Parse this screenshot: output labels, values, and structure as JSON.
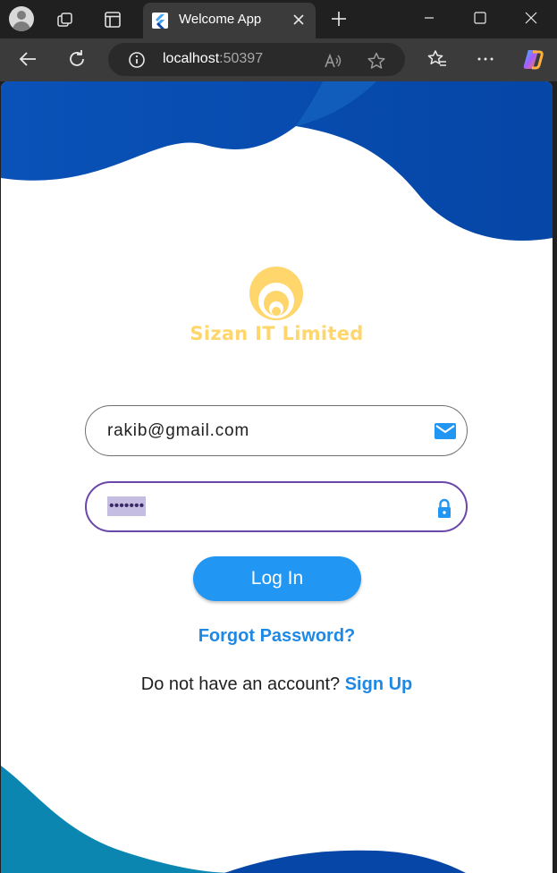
{
  "browser": {
    "tab_title": "Welcome App",
    "url_host": "localhost",
    "url_port": ":50397"
  },
  "page": {
    "brand_name": "Sizan IT Limited",
    "email_value": "rakib@gmail.com",
    "password_value": "•••••••",
    "login_label": "Log In",
    "forgot_label": "Forgot Password?",
    "signup_prompt": "Do not have an account?",
    "signup_label": "Sign Up"
  },
  "colors": {
    "wave_dark": "#0a4fb4",
    "wave_teal": "#0a86b0",
    "brand": "#ffd66b",
    "button": "#2196f3",
    "link": "#1e88e5",
    "focus_border": "#6a47a8"
  },
  "icons": {
    "email": "mail-icon",
    "password": "lock-icon"
  }
}
